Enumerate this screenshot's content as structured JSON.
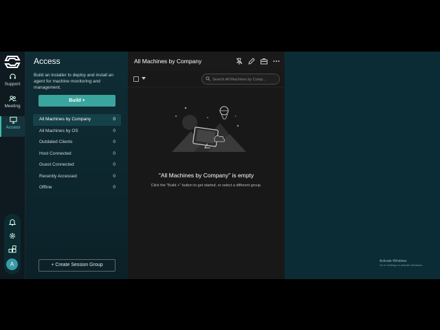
{
  "rail": {
    "items": [
      {
        "label": "Support",
        "icon": "headset-icon"
      },
      {
        "label": "Meeting",
        "icon": "people-icon"
      },
      {
        "label": "Access",
        "icon": "monitor-icon",
        "active": true
      }
    ],
    "bottom_icons": [
      "bell-icon",
      "gear-icon",
      "extensions-icon"
    ],
    "avatar_initial": "A"
  },
  "access_panel": {
    "title": "Access",
    "description": "Build an installer to deploy and install an agent for machine monitoring and management.",
    "build_button": "Build +",
    "nav": [
      {
        "label": "All Machines by Company",
        "count": "0",
        "active": true
      },
      {
        "label": "All Machines by OS",
        "count": "0"
      },
      {
        "label": "Outdated Clients",
        "count": "0"
      },
      {
        "label": "Host Connected",
        "count": "0"
      },
      {
        "label": "Guest Connected",
        "count": "0"
      },
      {
        "label": "Recently Accessed",
        "count": "0"
      },
      {
        "label": "Offline",
        "count": "0"
      }
    ],
    "create_button": "+ Create Session Group"
  },
  "main": {
    "title": "All Machines by Company",
    "search_placeholder": "Search All Machines by Comp...",
    "empty_title": "\"All Machines by Company\" is empty",
    "empty_desc": "Click the \"Build +\" button to get started, or select a different group."
  },
  "watermark": {
    "line1": "Activate Windows",
    "line2": "Go to Settings to activate Windows."
  },
  "colors": {
    "accent": "#3aa59c",
    "panel_bg": "#0f2d35",
    "main_bg": "#181818",
    "right_bg": "#0c2c35"
  }
}
